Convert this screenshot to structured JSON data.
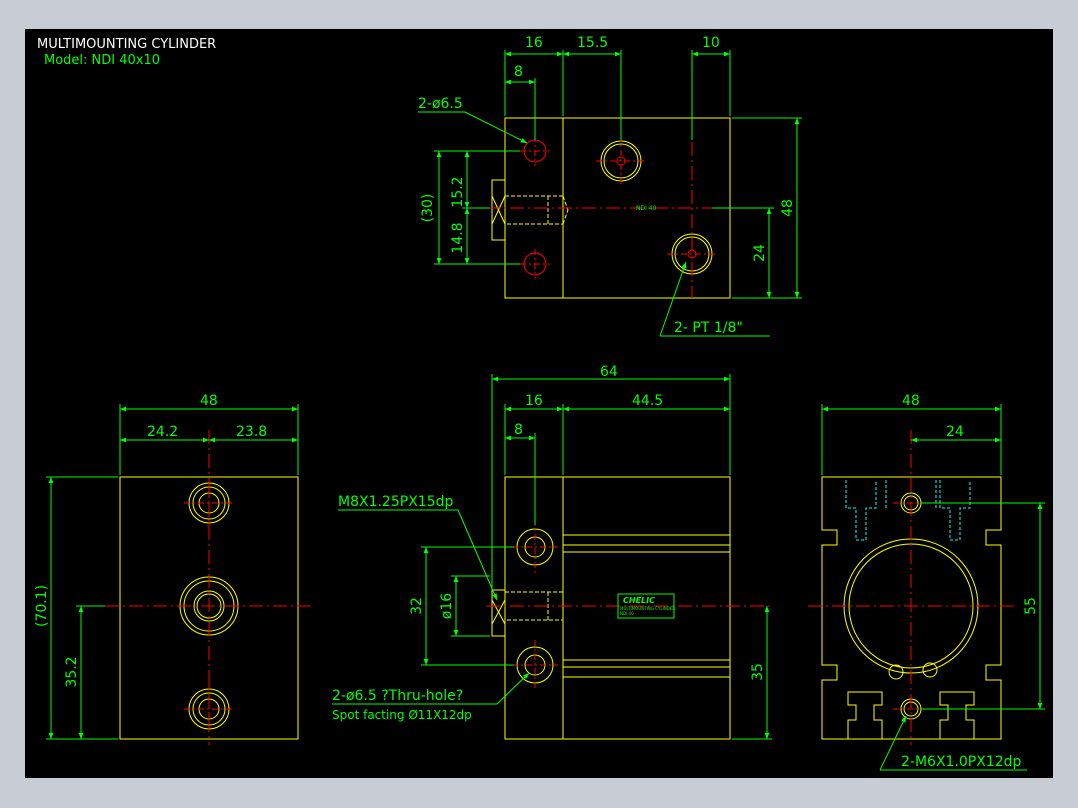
{
  "title": {
    "line1": "MULTIMOUNTING CYLINDER",
    "line2": "Model:  NDI 40x10"
  },
  "top_view": {
    "dims": {
      "d16": "16",
      "d15_5": "15.5",
      "d10": "10",
      "d8": "8",
      "d15_2": "15.2",
      "d14_8": "14.8",
      "d30": "(30)",
      "d48": "48",
      "d24": "24"
    },
    "callouts": {
      "holes": "2-ø6.5",
      "ports": "2-  PT 1/8\""
    },
    "label": "NDI 40"
  },
  "left_view": {
    "dims": {
      "d48": "48",
      "d24_2": "24.2",
      "d23_8": "23.8",
      "d70_1": "(70.1)",
      "d35_2": "35.2"
    }
  },
  "front_view": {
    "dims": {
      "d64": "64",
      "d16": "16",
      "d44_5": "44.5",
      "d8": "8",
      "d32": "32",
      "d16dia": "ø16",
      "d35": "35"
    },
    "callouts": {
      "thread": "M8X1.25PX15dp",
      "holes_line1": "2-ø6.5 ?Thru-hole?",
      "holes_line2": "Spot facting  Ø11X12dp"
    },
    "plate": {
      "brand": "CHELIC",
      "line1": "MULTIMOUNTING CYLINDER",
      "line2": "NDI 40"
    }
  },
  "right_view": {
    "dims": {
      "d48": "48",
      "d24": "24",
      "d55": "55"
    },
    "callouts": {
      "thread": "2-M6X1.0PX12dp"
    }
  }
}
